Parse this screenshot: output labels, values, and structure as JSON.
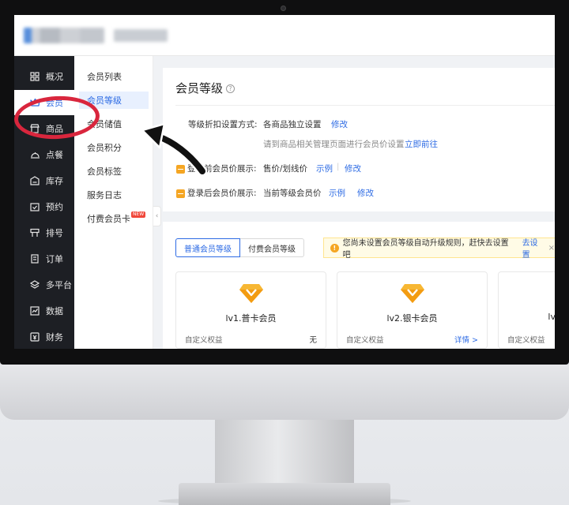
{
  "sidebar": {
    "items": [
      {
        "label": "概况",
        "icon": "grid-icon",
        "active": false
      },
      {
        "label": "会员",
        "icon": "crown-icon",
        "active": true
      },
      {
        "label": "商品",
        "icon": "shop-icon",
        "active": false
      },
      {
        "label": "点餐",
        "icon": "dish-icon",
        "active": false
      },
      {
        "label": "库存",
        "icon": "inventory-icon",
        "active": false
      },
      {
        "label": "预约",
        "icon": "calendar-check-icon",
        "active": false
      },
      {
        "label": "排号",
        "icon": "queue-icon",
        "active": false
      },
      {
        "label": "订单",
        "icon": "order-icon",
        "active": false
      },
      {
        "label": "多平台",
        "icon": "layers-icon",
        "active": false
      },
      {
        "label": "数据",
        "icon": "chart-icon",
        "active": false
      },
      {
        "label": "财务",
        "icon": "finance-icon",
        "active": false
      }
    ]
  },
  "subnav": {
    "items": [
      {
        "label": "会员列表"
      },
      {
        "label": "会员等级",
        "active": true
      },
      {
        "label": "会员储值"
      },
      {
        "label": "会员积分"
      },
      {
        "label": "会员标签"
      },
      {
        "label": "服务日志"
      },
      {
        "label": "付费会员卡",
        "badge": "NEW"
      }
    ]
  },
  "settings": {
    "title": "会员等级",
    "help": "?",
    "discount_label": "等级折扣设置方式:",
    "discount_value": "各商品独立设置",
    "discount_edit": "修改",
    "discount_hint": "请到商品相关管理页面进行会员价设置",
    "discount_goto": "立即前往",
    "before_login_label": "登录前会员价展示:",
    "before_login_value": "售价/划线价",
    "before_login_example": "示例",
    "before_login_sep": "|",
    "before_login_edit": "修改",
    "after_login_label": "登录后会员价展示:",
    "after_login_value": "当前等级会员价",
    "after_login_example": "示例",
    "after_login_edit": "修改"
  },
  "levels": {
    "tabs": [
      {
        "label": "普通会员等级",
        "active": true
      },
      {
        "label": "付费会员等级",
        "active": false
      }
    ],
    "alert_icon": "!",
    "alert_text": "您尚未设置会员等级自动升级规则，赶快去设置吧",
    "alert_link": "去设置",
    "alert_close": "×",
    "cards": [
      {
        "name": "lv1.普卡会员",
        "benefit_label": "自定义权益",
        "benefit_value": "无"
      },
      {
        "name": "lv2.银卡会员",
        "benefit_label": "自定义权益",
        "benefit_value": "详情 >"
      },
      {
        "name": "lv",
        "benefit_label": "自定义权益",
        "benefit_value": ""
      }
    ]
  },
  "colors": {
    "accent": "#2d6be4",
    "sidebar_bg": "#1d1f24",
    "annotation_ring": "#d9263d",
    "gem": "#f5a623"
  }
}
